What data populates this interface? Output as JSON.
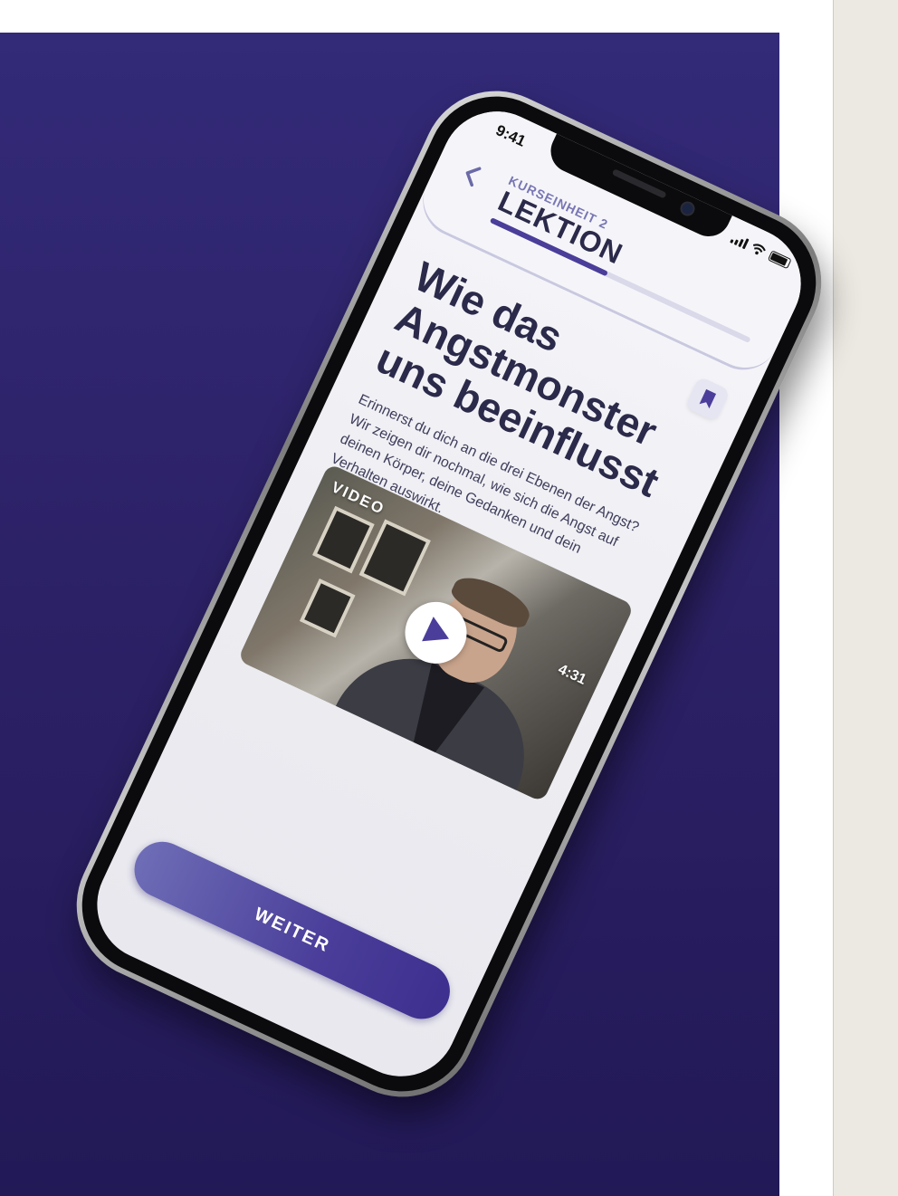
{
  "status_bar": {
    "time": "9:41"
  },
  "header": {
    "eyebrow": "KURSEINHEIT 2",
    "title": "LEKTION",
    "back_icon": "chevron-left-icon",
    "progress_fraction": 0.45
  },
  "lesson": {
    "title": "Wie das Angstmonster uns beeinflusst",
    "description": "Erinnerst du dich an die drei Ebenen der Angst? Wir zeigen dir nochmal, wie sich die Angst auf deinen Körper, deine Gedanken und dein Verhalten auswirkt.",
    "bookmark_icon": "bookmark-icon"
  },
  "video": {
    "tag": "VIDEO",
    "duration": "4:31",
    "play_icon": "play-icon"
  },
  "cta": {
    "label": "WEITER"
  },
  "colors": {
    "background": "#2b2064",
    "accent": "#4a3e9a",
    "title_text": "#2b2a4a"
  }
}
